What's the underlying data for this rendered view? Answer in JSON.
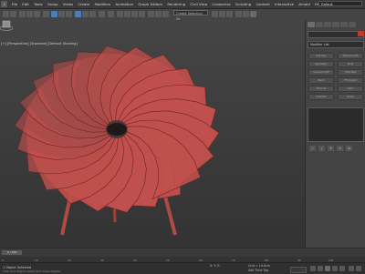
{
  "menubar": {
    "logo": "3",
    "items": [
      "File",
      "Edit",
      "Tools",
      "Group",
      "Views",
      "Create",
      "Modifiers",
      "Animation",
      "Graph Editors",
      "Rendering",
      "Civil View",
      "Customize",
      "Scripting",
      "Content",
      "Interactive",
      "Arnold",
      "Help"
    ],
    "workspace": "Default"
  },
  "toolbar": {
    "selection_set": "Create Selection Se"
  },
  "viewport": {
    "label": "[+] [Perspective] [Standard] [Default Shading]",
    "model_color": "#c0504d",
    "background": "#3c3c3c"
  },
  "command_panel": {
    "modifier_list": "Modifier List",
    "buttons": [
      "Edit Poly",
      "Turbosmooth",
      "Symmetry",
      "Shell",
      "Unwrap UVW",
      "UVW Map",
      "Bend",
      "FFD 4x4x4",
      "Extrude",
      "Lathe",
      "Chamfer",
      "Noise"
    ],
    "stack_controls": [
      "⊥",
      "|",
      "∀",
      "⊘",
      "⚙"
    ]
  },
  "timeline": {
    "slider": "0 / 100",
    "ticks": [
      "0",
      "10",
      "20",
      "30",
      "40",
      "50",
      "60",
      "70",
      "80",
      "90",
      "100"
    ]
  },
  "status": {
    "message": "1 Object Selected",
    "hint": "Click and drag to select and move objects",
    "coords": "X: Y: Z:",
    "grid": "Grid = 10.0cm",
    "time_tag": "Add Time Tag"
  }
}
